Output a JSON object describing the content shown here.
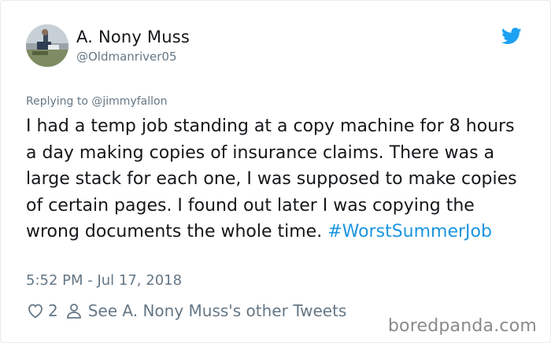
{
  "author": {
    "display_name": "A. Nony Muss",
    "handle": "@Oldmanriver05",
    "avatar": "avatar-photo"
  },
  "brand_icon": "twitter-bird-icon",
  "colors": {
    "twitter_blue": "#1da1f2",
    "hashtag": "#1b95e0",
    "secondary_text": "#657786",
    "primary_text": "#14171a"
  },
  "reply": {
    "prefix": "Replying to",
    "mention": "@jimmyfallon"
  },
  "tweet": {
    "body": "I had a temp job standing at a copy machine for 8 hours a day making copies of insurance claims. There was a large stack for each one, I was supposed to make copies of certain pages. I found out later I was copying the wrong documents the whole time.",
    "hashtag": "#WorstSummerJob",
    "timestamp": "5:52 PM - Jul 17, 2018"
  },
  "actions": {
    "like_icon": "heart-icon",
    "like_count": "2",
    "profile_icon": "person-icon",
    "other_tweets_label": "See A. Nony Muss's other Tweets"
  },
  "watermark": "boredpanda.com"
}
